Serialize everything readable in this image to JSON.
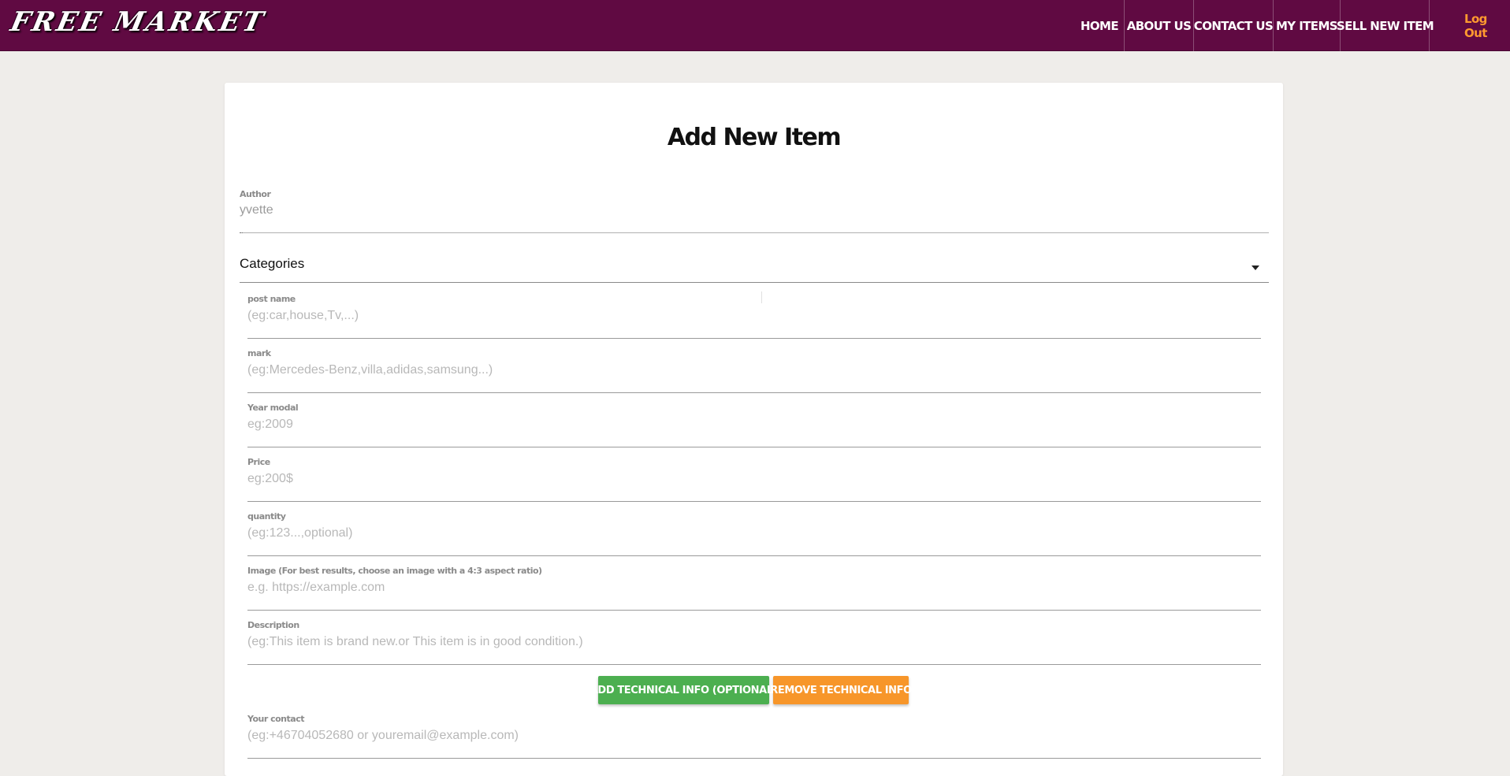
{
  "brand": "FREE MARKET",
  "nav": {
    "items": [
      "HOME",
      "ABOUT US",
      "CONTACT US",
      "MY ITEMS",
      "SELL NEW ITEM"
    ],
    "logout": "Log Out"
  },
  "colors": {
    "navbar": "#600a42",
    "page_bg": "#efedea",
    "logout": "#ff9a2f",
    "add_button": "#4caf50",
    "remove_button": "#f7962a"
  },
  "form": {
    "title": "Add New Item",
    "author": {
      "label": "Author",
      "value": "yvette"
    },
    "categories": {
      "label": "Categories",
      "icon": "caret-down-icon"
    },
    "fields": [
      {
        "label": "post name",
        "placeholder": "(eg:car,house,Tv,...)"
      },
      {
        "label": "mark",
        "placeholder": "(eg:Mercedes-Benz,villa,adidas,samsung...)"
      },
      {
        "label": "Year modal",
        "placeholder": "eg:2009"
      },
      {
        "label": "Price",
        "placeholder": "eg:200$"
      },
      {
        "label": "quantity",
        "placeholder": "(eg:123...,optional)"
      },
      {
        "label": "Image (For best results, choose an image with a 4:3 aspect ratio)",
        "placeholder": "e.g. https://example.com"
      },
      {
        "label": "Description",
        "placeholder": "(eg:This item is brand new.or This item is in good condition.)"
      }
    ],
    "buttons": {
      "add_tech": "ADD TECHNICAL INFO (OPTIONAL)",
      "remove_tech": "REMOVE TECHNICAL INFO"
    },
    "contact": {
      "label": "Your contact",
      "placeholder": "(eg:+46704052680 or youremail@example.com)"
    }
  }
}
